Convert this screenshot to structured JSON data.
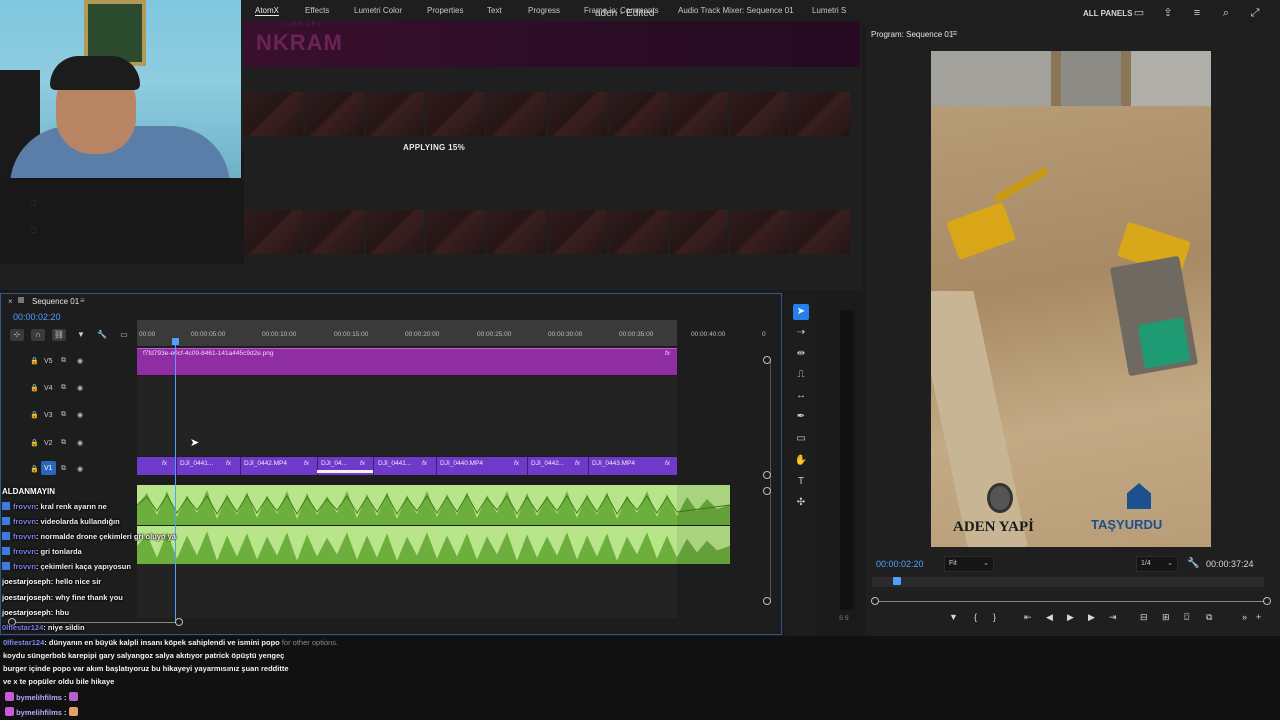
{
  "window": {
    "title": "aden - Edited",
    "all_panels": "ALL PANELS"
  },
  "upper_panel": {
    "tabs": [
      "AtomX",
      "Effects",
      "Lumetri Color",
      "Properties",
      "Text",
      "Progress",
      "Frame.io: Comments",
      "Audio Track Mixer: Sequence 01",
      "Lumetri S"
    ],
    "banner_logo": "NKRAM",
    "banner_sub": "LIBRARY",
    "status": "APPLYING 15%"
  },
  "program_monitor": {
    "title": "Program: Sequence 01",
    "timecode_current": "00:00:02:20",
    "fit": "Fit",
    "resolution": "1/4",
    "timecode_duration": "00:00:37:24",
    "logo_left": "ADEN YAPİ",
    "logo_right": "TAŞYURDU"
  },
  "timeline": {
    "sequence_name": "Sequence 01",
    "timecode": "00:00:02:20",
    "ruler_ticks": [
      "00:00",
      "00:00:05:00",
      "00:00:10:00",
      "00:00:15:00",
      "00:00:20:00",
      "00:00:25:00",
      "00:00:30:00",
      "00:00:35:00",
      "00:00:40:00",
      "0"
    ],
    "tracks": [
      "V5",
      "V4",
      "V3",
      "V2",
      "V1"
    ],
    "v5_clip": "f7fd793e-e0cf-4c09-8461-141a445c9d2e.png",
    "v1_clips": [
      "DJI_0441...",
      "DJI_0442.MP4",
      "DJI_04...",
      "DJI_0441...",
      "DJI_0440.MP4",
      "DJI_0442...",
      "DJI_0443.MP4"
    ],
    "fx": "fx"
  },
  "chat": {
    "header": "ALDANMAYIN",
    "messages": [
      {
        "user": "frovvn",
        "text": ": kral renk ayarın ne"
      },
      {
        "user": "frovvn",
        "text": ": videolarda kullandığın"
      },
      {
        "user": "frovvn",
        "text": ": normalde drone çekimleri gri oluyo ya"
      },
      {
        "user": "frovvn",
        "text": ": gri tonlarda"
      },
      {
        "user": "frovvn",
        "text": ": çekimleri kaça yapıyosun"
      },
      {
        "user": "joestarjoseph",
        "text": ": hello nice sir"
      },
      {
        "user": "joestarjoseph",
        "text": ": why fine thank you"
      },
      {
        "user": "joestarjoseph",
        "text": ": hbu"
      },
      {
        "user": "0lfiestar124",
        "text": ": niye sildin"
      }
    ]
  },
  "bottom_chat": {
    "line1_user": "0lfiestar124",
    "line1_text": ": dünyanın en büyük kalpli insanı köpek sahiplendi ve ismini popo",
    "line1_faint": "for other options.",
    "line2": "koydu süngerbob karepipi gary salyangoz salya akıtıyor patrick öpüştü yengeç",
    "line3": "burger içinde popo var akım başlatıyoruz bu hikayeyi yayarmısınız şuan redditte",
    "line4": "ve x te popüler oldu bile hikaye",
    "line5_user": "bymelihfilms",
    "line5_text": ":",
    "line6_user": "bymelihfilms",
    "line6_text": ":"
  },
  "meter": {
    "label": "S S"
  }
}
